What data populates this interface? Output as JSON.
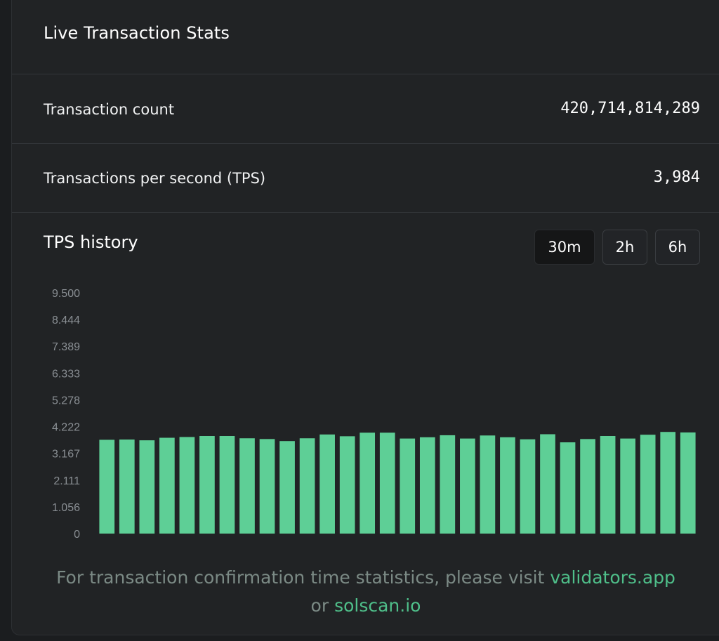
{
  "header": {
    "title": "Live Transaction Stats"
  },
  "stats": [
    {
      "label": "Transaction count",
      "value": "420,714,814,289"
    },
    {
      "label": "Transactions per second (TPS)",
      "value": "3,984"
    }
  ],
  "tps_history": {
    "title": "TPS history",
    "ranges": [
      "30m",
      "2h",
      "6h"
    ],
    "active_range": "30m"
  },
  "footer": {
    "text_before": "For transaction confirmation time statistics, please visit",
    "link1": "validators.app",
    "text_middle": "or",
    "link2": "solscan.io"
  },
  "colors": {
    "bar": "#5ecf96",
    "link": "#4fbf8a",
    "axis_text": "#8a8f94"
  },
  "chart_data": {
    "type": "bar",
    "ylim": [
      0,
      9500
    ],
    "y_ticks": [
      "0",
      "1.056",
      "2.111",
      "3.167",
      "4.222",
      "5.278",
      "6.333",
      "7.389",
      "8.444",
      "9.500"
    ],
    "grid": false,
    "title": "",
    "xlabel": "",
    "ylabel": "",
    "values": [
      3700,
      3710,
      3680,
      3780,
      3810,
      3850,
      3850,
      3760,
      3730,
      3650,
      3760,
      3910,
      3840,
      3980,
      3980,
      3750,
      3800,
      3880,
      3750,
      3870,
      3800,
      3720,
      3920,
      3600,
      3730,
      3850,
      3750,
      3900,
      4010,
      3990
    ]
  }
}
